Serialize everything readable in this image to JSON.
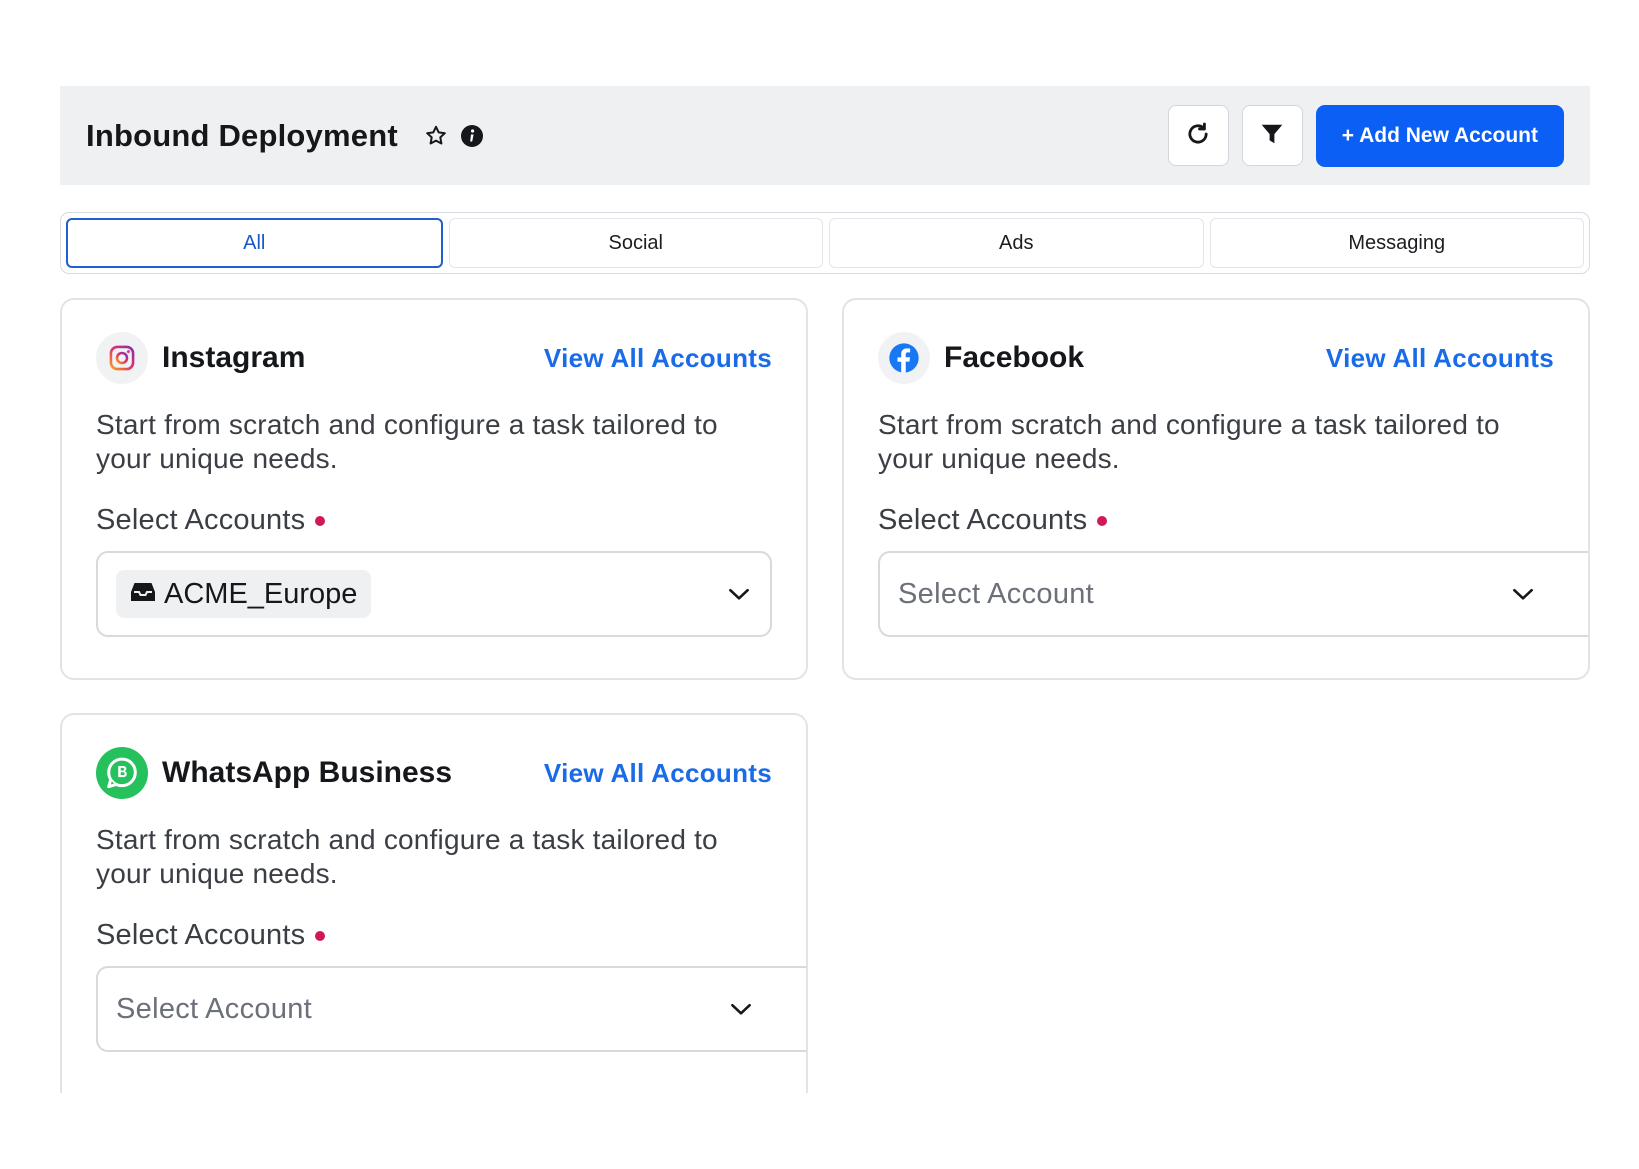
{
  "header": {
    "title": "Inbound Deployment",
    "add_button_label": "+ Add New Account"
  },
  "tabs": [
    {
      "label": "All",
      "active": true
    },
    {
      "label": "Social",
      "active": false
    },
    {
      "label": "Ads",
      "active": false
    },
    {
      "label": "Messaging",
      "active": false
    }
  ],
  "cards": {
    "instagram": {
      "title": "Instagram",
      "link": "View All Accounts",
      "description": "Start from scratch and configure a task tailored to your unique needs.",
      "field_label": "Select Accounts",
      "selected_chip": "ACME_Europe"
    },
    "facebook": {
      "title": "Facebook",
      "link": "View All Accounts",
      "description": "Start from scratch and configure a task tailored to your unique needs.",
      "field_label": "Select Accounts",
      "placeholder": "Select Account"
    },
    "whatsapp": {
      "title": "WhatsApp Business",
      "link": "View All Accounts",
      "description": "Start from scratch and configure a task tailored to your unique needs.",
      "field_label": "Select Accounts",
      "placeholder": "Select Account"
    }
  },
  "colors": {
    "primary": "#0c5ff5",
    "link": "#1a6be8",
    "required": "#d1195a",
    "whatsapp": "#25c15c",
    "facebook": "#1877f2"
  },
  "icons": [
    "star-icon",
    "info-icon",
    "refresh-icon",
    "filter-icon",
    "instagram-icon",
    "facebook-icon",
    "whatsapp-business-icon",
    "inbox-icon",
    "chevron-down-icon"
  ]
}
